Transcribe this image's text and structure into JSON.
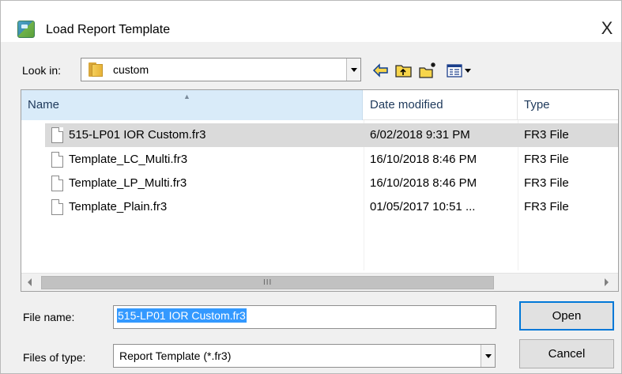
{
  "dialog": {
    "title": "Load Report Template",
    "close_glyph": "X",
    "app_icon": "report-app-icon"
  },
  "lookin": {
    "label": "Look in:",
    "value": "custom",
    "icon": "folder-icon"
  },
  "toolbar": {
    "back_icon": "back-arrow-icon",
    "up_icon": "up-folder-icon",
    "new_folder_icon": "new-folder-icon",
    "view_menu_icon": "view-menu-icon"
  },
  "columns": {
    "name": "Name",
    "date": "Date modified",
    "type": "Type"
  },
  "files": [
    {
      "name": "515-LP01 IOR Custom.fr3",
      "date": "6/02/2018 9:31 PM",
      "type": "FR3 File"
    },
    {
      "name": "Template_LC_Multi.fr3",
      "date": "16/10/2018 8:46 PM",
      "type": "FR3 File"
    },
    {
      "name": "Template_LP_Multi.fr3",
      "date": "16/10/2018 8:46 PM",
      "type": "FR3 File"
    },
    {
      "name": "Template_Plain.fr3",
      "date": "01/05/2017 10:51 ...",
      "type": "FR3 File"
    }
  ],
  "scrollbar": {
    "grip": "III"
  },
  "filename": {
    "label": "File name:",
    "value": "515-LP01 IOR Custom.fr3"
  },
  "filetype": {
    "label": "Files of type:",
    "value": "Report Template (*.fr3)"
  },
  "buttons": {
    "open": "Open",
    "cancel": "Cancel"
  },
  "colors": {
    "selection_highlight": "#3399ff",
    "row_selected": "#dadada",
    "default_button_border": "#0078d7",
    "column_header_sorted": "#d9ebf9"
  }
}
